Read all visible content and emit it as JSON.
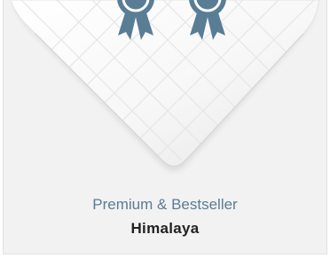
{
  "product": {
    "subtitle": "Premium & Bestseller",
    "title": "Himalaya",
    "image": "quilted-white-duvet-corner",
    "badges": [
      "award-rosette-icon",
      "award-rosette-icon"
    ]
  },
  "colors": {
    "card_background": "#f2f2f2",
    "subtitle": "#587d95",
    "title": "#222222",
    "badge": "#587d95"
  }
}
